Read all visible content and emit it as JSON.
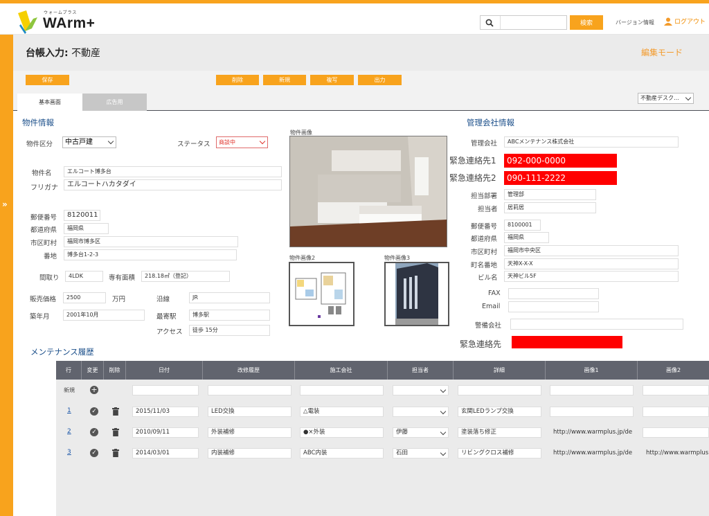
{
  "app": {
    "logo_kana": "ウォームプラス",
    "logo_word": "WArm+"
  },
  "header": {
    "search_placeholder": "",
    "search_button": "検索",
    "version": "バージョン情報",
    "logout": "ログアウト"
  },
  "title": {
    "prefix": "台帳入力:",
    "name": "不動産",
    "mode": "編集モード"
  },
  "toolbar": {
    "save": "保存",
    "delete": "削除",
    "new": "新規",
    "copy": "複写",
    "output": "出力"
  },
  "tabs": {
    "basic": "基本画面",
    "ad": "広告用",
    "desk_select": "不動産デスク…"
  },
  "property": {
    "section": "物件情報",
    "kubun_label": "物件区分",
    "kubun_value": "中古戸建",
    "status_label": "ステータス",
    "status_value": "商談中",
    "name_label": "物件名",
    "name_value": "エルコート博多台",
    "kana_label": "フリガナ",
    "kana_value": "エルコートハカタダイ",
    "zip_label": "郵便番号",
    "zip_value": "8120011",
    "pref_label": "都道府県",
    "pref_value": "福岡県",
    "city_label": "市区町村",
    "city_value": "福岡市博多区",
    "banchi_label": "番地",
    "banchi_value": "博多台1-2-3",
    "madori_label": "間取り",
    "madori_value": "4LDK",
    "area_label": "専有面積",
    "area_value": "218.18㎡（登記）",
    "price_label": "販売価格",
    "price_value": "2500",
    "price_unit": "万円",
    "line_label": "沿線",
    "line_value": "JR",
    "year_label": "築年月",
    "year_value": "2001年10月",
    "station_label": "最寄駅",
    "station_value": "博多駅",
    "access_label": "アクセス",
    "access_value": "徒歩 15分",
    "image_label": "物件画像",
    "image2_label": "物件画像2",
    "image3_label": "物件画像3"
  },
  "management": {
    "section": "管理会社情報",
    "company_label": "管理会社",
    "company_value": "ABCメンテナンス株式会社",
    "emergency1_label": "緊急連絡先1",
    "emergency1_value": "092-000-0000",
    "emergency2_label": "緊急連絡先2",
    "emergency2_value": "090-111-2222",
    "dept_label": "担当部署",
    "dept_value": "管理部",
    "person_label": "担当者",
    "person_value": "居莉居",
    "zip_label": "郵便番号",
    "zip_value": "8100001",
    "pref_label": "都道府県",
    "pref_value": "福岡県",
    "city_label": "市区町村",
    "city_value": "福岡市中央区",
    "town_label": "町名番地",
    "town_value": "天神X-X-X",
    "bldg_label": "ビル名",
    "bldg_value": "天神ビル5F",
    "fax_label": "FAX",
    "fax_value": "",
    "email_label": "Email",
    "email_value": "",
    "security_label": "警備会社",
    "security_value": "",
    "emergency_label": "緊急連絡先",
    "emergency_value": ""
  },
  "maintenance": {
    "section": "メンテナンス履歴",
    "headers": [
      "行",
      "変更",
      "削除",
      "日付",
      "改修履歴",
      "施工会社",
      "担当者",
      "詳細",
      "画像1",
      "画像2"
    ],
    "new_label": "新規",
    "rows": [
      {
        "no": "1",
        "date": "2015/11/03",
        "work": "LED交換",
        "company": "△電装",
        "person": "",
        "detail": "玄関LEDランプ交換",
        "img1": "",
        "img2": ""
      },
      {
        "no": "2",
        "date": "2010/09/11",
        "work": "外装補修",
        "company": "●×外装",
        "person": "伊藤",
        "detail": "塗装落ち修正",
        "img1": "http://www.warmplus.jp/de",
        "img2": ""
      },
      {
        "no": "3",
        "date": "2014/03/01",
        "work": "内装補修",
        "company": "ABC内装",
        "person": "石田",
        "detail": "リビングクロス補修",
        "img1": "http://www.warmplus.jp/de",
        "img2": "http://www.warmplus"
      }
    ]
  },
  "colors": {
    "accent": "#f8a31d",
    "heading": "#1b4f8a",
    "emergency": "#ff0000",
    "grid_header": "#61646e"
  }
}
